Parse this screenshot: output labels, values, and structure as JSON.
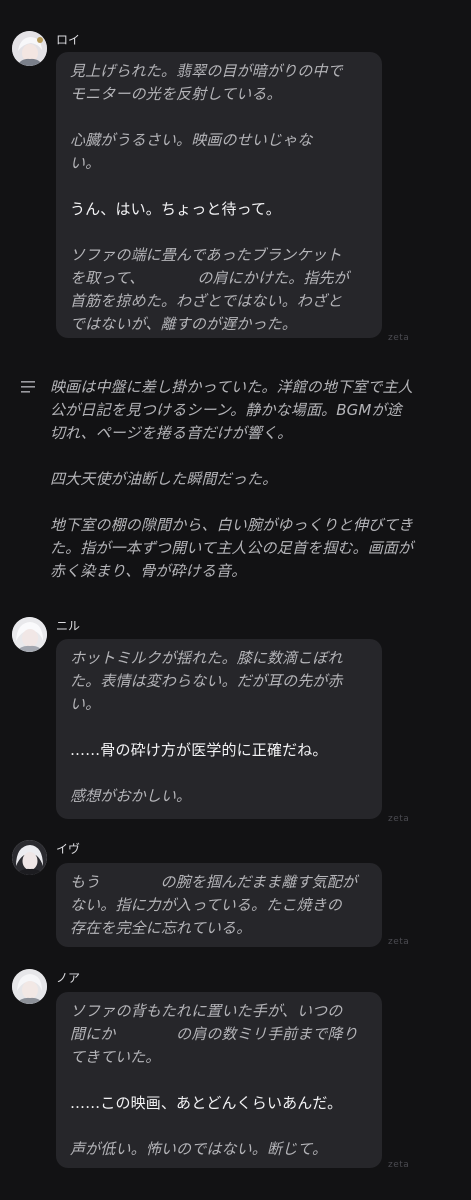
{
  "watermark": "zeta",
  "messages": [
    {
      "name": "ロイ",
      "paragraphs": [
        {
          "style": "narration",
          "text": "見上げられた。翡翠の目が暗がりの中で\nモニターの光を反射している。"
        },
        {
          "style": "narration",
          "text": "心臓がうるさい。映画のせいじゃな\nい。"
        },
        {
          "style": "dialogue",
          "text": "うん、はい。ちょっと待って。"
        },
        {
          "style": "narration",
          "text": "ソファの端に畳んであったブランケット\nを取って、　　　　の肩にかけた。指先が\n首筋を掠めた。わざとではない。わざと\nではないが、離すのが遅かった。"
        }
      ]
    },
    {
      "name": "ニル",
      "paragraphs": [
        {
          "style": "narration",
          "text": "ホットミルクが揺れた。膝に数滴こぼれ\nた。表情は変わらない。だが耳の先が赤\nい。"
        },
        {
          "style": "dialogue",
          "text": "……骨の砕け方が医学的に正確だね。"
        },
        {
          "style": "narration",
          "text": "感想がおかしい。"
        }
      ]
    },
    {
      "name": "イヴ",
      "paragraphs": [
        {
          "style": "narration",
          "text": "もう　　　　の腕を掴んだまま離す気配が\nない。指に力が入っている。たこ焼きの\n存在を完全に忘れている。"
        }
      ]
    },
    {
      "name": "ノア",
      "paragraphs": [
        {
          "style": "narration",
          "text": "ソファの背もたれに置いた手が、いつの\n間にか　　　　の肩の数ミリ手前まで降り\nてきていた。"
        },
        {
          "style": "dialogue",
          "text": "……この映画、あとどんくらいあんだ。"
        },
        {
          "style": "narration",
          "text": "声が低い。怖いのではない。断じて。"
        }
      ]
    }
  ],
  "narration": {
    "icon": "list-icon",
    "paragraphs": [
      "映画は中盤に差し掛かっていた。洋館の地下室で主人\n公が日記を見つけるシーン。静かな場面。BGMが途\n切れ、ページを捲る音だけが響く。",
      "四大天使が油断した瞬間だった。",
      "地下室の棚の隙間から、白い腕がゆっくりと伸びてき\nた。指が一本ずつ開いて主人公の足首を掴む。画面が\n赤く染まり、骨が砕ける音。"
    ]
  },
  "colors": {
    "background": "#121214",
    "bubble": "#26262a",
    "narration_text": "#b4b4b8",
    "dialogue_text": "#f2f2f4"
  }
}
